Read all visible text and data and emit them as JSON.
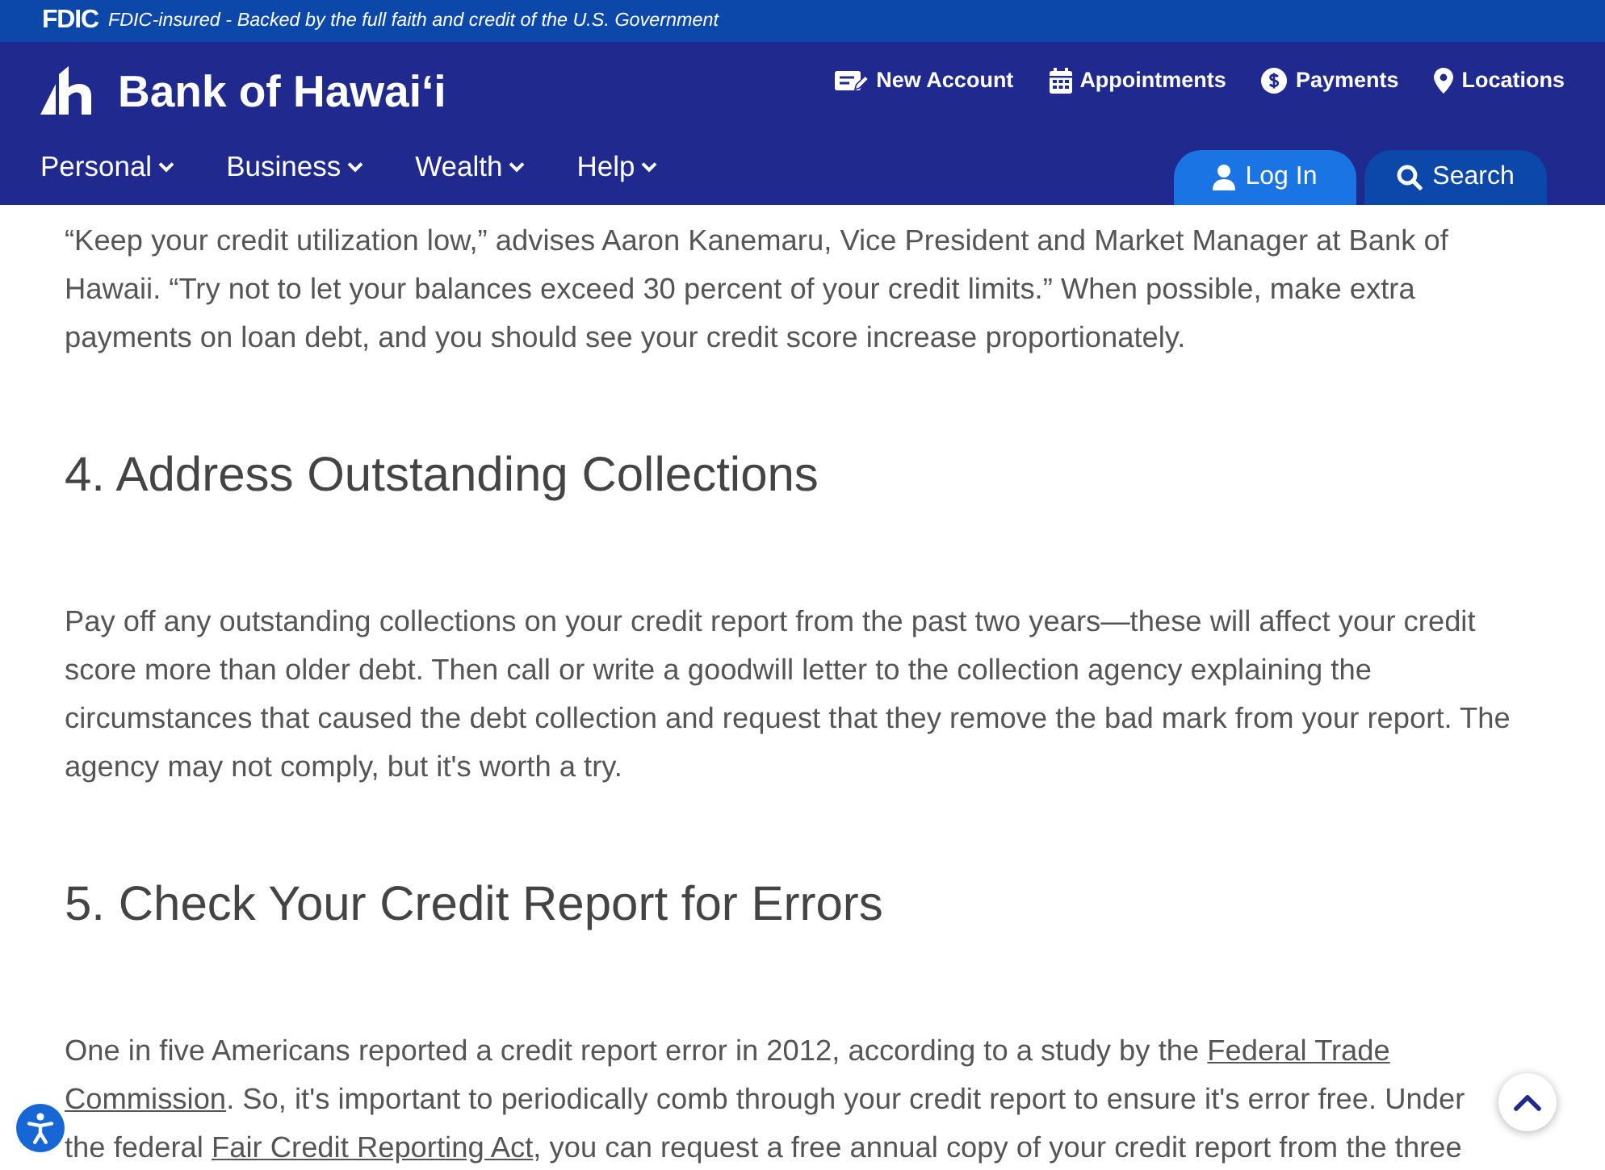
{
  "fdic_bar": {
    "logo": "FDIC",
    "text": "FDIC-insured - Backed by the full faith and credit of the U.S. Government"
  },
  "header": {
    "brand": "Bank of Hawaiʻi",
    "utility_links": [
      {
        "kind": "account",
        "label": "New Account"
      },
      {
        "kind": "appointments",
        "label": "Appointments"
      },
      {
        "kind": "payments",
        "label": "Payments"
      },
      {
        "kind": "locations",
        "label": "Locations"
      }
    ],
    "nav": [
      {
        "label": "Personal"
      },
      {
        "label": "Business"
      },
      {
        "label": "Wealth"
      },
      {
        "label": "Help"
      }
    ],
    "actions": [
      {
        "kind": "login",
        "label": "Log In"
      },
      {
        "kind": "search",
        "label": "Search"
      }
    ]
  },
  "article": [
    {
      "kind": "paragraph",
      "parts": [
        {
          "kind": "text",
          "text": "“Keep your credit utilization low,” advises Aaron Kanemaru, Vice President and Market Manager at Bank of Hawaii. “Try not to let your balances exceed 30 percent of your credit limits.” When possible, make extra payments on loan debt, and you should see your credit score increase proportionately."
        }
      ]
    },
    {
      "kind": "heading",
      "text": "4. Address Outstanding Collections"
    },
    {
      "kind": "paragraph",
      "parts": [
        {
          "kind": "text",
          "text": "Pay off any outstanding collections on your credit report from the past two years—these will affect your credit score more than older debt. Then call or write a goodwill letter to the collection agency explaining the circumstances that caused the debt collection and request that they remove the bad mark from your report. The agency may not comply, but it's worth a try."
        }
      ]
    },
    {
      "kind": "heading",
      "text": "5. Check Your Credit Report for Errors"
    },
    {
      "kind": "paragraph",
      "parts": [
        {
          "kind": "text",
          "text": "One in five Americans reported a credit report error in 2012, according to a study by the "
        },
        {
          "kind": "link",
          "lines": [
            "Federal Trade",
            "Commission"
          ]
        },
        {
          "kind": "text",
          "text": ". So, it's important to periodically comb through your credit report to ensure it's error free. Under the federal "
        },
        {
          "kind": "link",
          "lines": [
            "Fair Credit Reporting Act"
          ]
        },
        {
          "kind": "text",
          "text": ", you can request a free annual copy of your credit report from the three"
        }
      ]
    }
  ]
}
